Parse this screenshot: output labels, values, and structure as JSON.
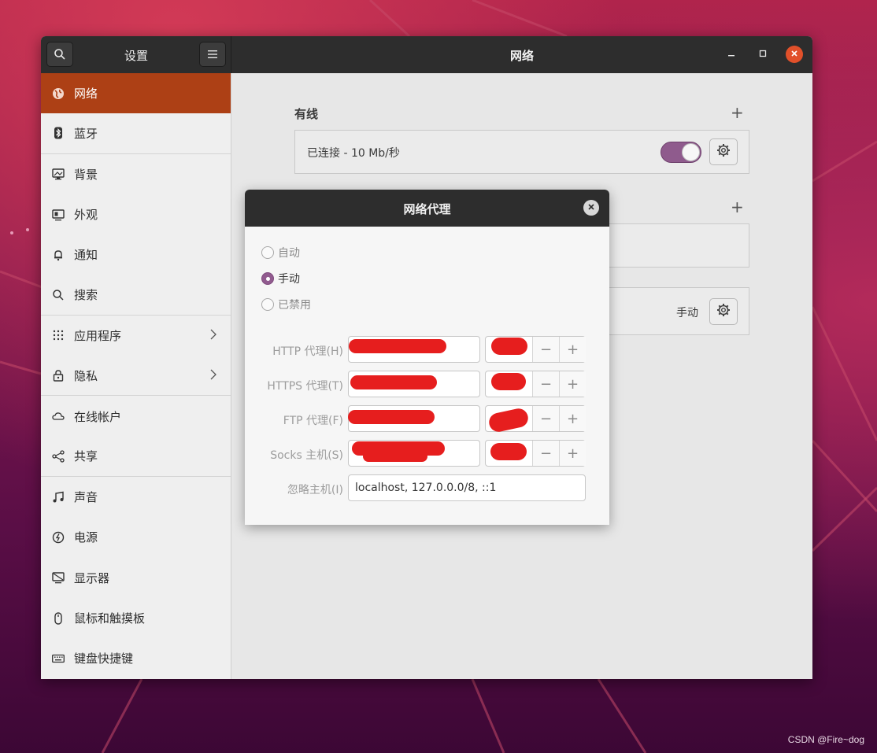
{
  "window": {
    "sidebar_title": "设置",
    "title": "网络"
  },
  "sidebar": {
    "items": [
      {
        "label": "网络",
        "icon": "globe-icon",
        "active": true
      },
      {
        "label": "蓝牙",
        "icon": "bluetooth-icon"
      },
      {
        "label": "背景",
        "icon": "background-icon"
      },
      {
        "label": "外观",
        "icon": "appearance-icon"
      },
      {
        "label": "通知",
        "icon": "bell-icon"
      },
      {
        "label": "搜索",
        "icon": "search-icon"
      },
      {
        "label": "应用程序",
        "icon": "apps-grid-icon",
        "chevron": true
      },
      {
        "label": "隐私",
        "icon": "lock-icon",
        "chevron": true
      },
      {
        "label": "在线帐户",
        "icon": "cloud-icon"
      },
      {
        "label": "共享",
        "icon": "share-icon"
      },
      {
        "label": "声音",
        "icon": "music-note-icon"
      },
      {
        "label": "电源",
        "icon": "power-icon"
      },
      {
        "label": "显示器",
        "icon": "display-icon"
      },
      {
        "label": "鼠标和触摸板",
        "icon": "mouse-icon"
      },
      {
        "label": "键盘快捷键",
        "icon": "keyboard-icon"
      }
    ]
  },
  "network": {
    "wired_heading": "有线",
    "wired_status": "已连接 - 10 Mb/秒",
    "wired_enabled": true,
    "proxy_value": "手动"
  },
  "proxy_dialog": {
    "title": "网络代理",
    "modes": [
      {
        "label": "自动",
        "selected": false
      },
      {
        "label": "手动",
        "selected": true
      },
      {
        "label": "已禁用",
        "selected": false
      }
    ],
    "fields": [
      {
        "label": "HTTP 代理(H)"
      },
      {
        "label": "HTTPS 代理(T)"
      },
      {
        "label": "FTP 代理(F)"
      },
      {
        "label": "Socks 主机(S)"
      }
    ],
    "ignore_label": "忽略主机(I)",
    "ignore_value": "localhost, 127.0.0.0/8, ::1"
  },
  "watermark": "CSDN @Fire~dog",
  "colors": {
    "accent": "#ad4015",
    "toggle": "#8f5b8d",
    "close": "#e1502a",
    "redaction": "#e61e1e"
  }
}
